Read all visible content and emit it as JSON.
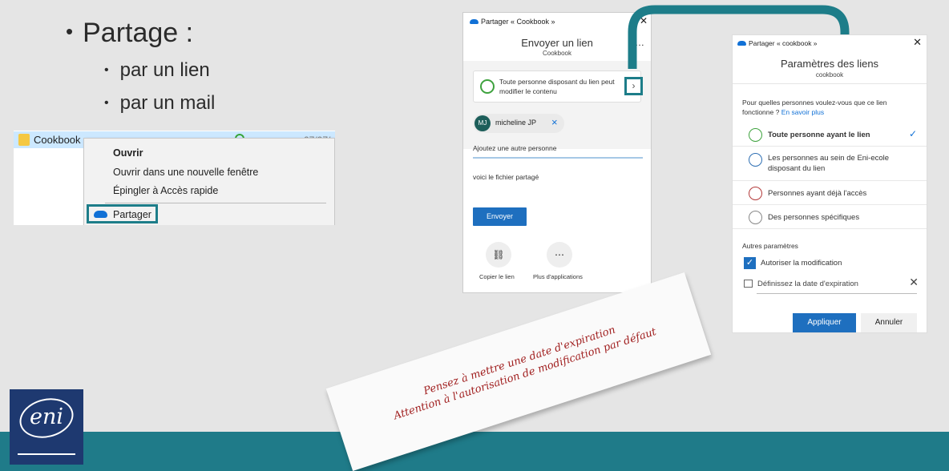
{
  "bullets": {
    "main": "Partage :",
    "sub1": "par un lien",
    "sub2": "par un mail"
  },
  "explorer": {
    "folder_name": "Cookbook",
    "date": "07/07/",
    "menu": [
      "Ouvrir",
      "Ouvrir dans une nouvelle fenêtre",
      "Épingler à Accès rapide",
      "Partager"
    ]
  },
  "send_link": {
    "window_title": "Partager « Cookbook »",
    "heading": "Envoyer un lien",
    "subheading": "Cookbook",
    "link_desc": "Toute personne disposant du lien peut modifier le contenu",
    "chip_initials": "MJ",
    "chip_name": "micheline JP",
    "add_placeholder": "Ajoutez une autre personne",
    "message": "voici le fichier partagé",
    "send_button": "Envoyer",
    "copy_link": "Copier le lien",
    "more_apps": "Plus d'applications"
  },
  "link_settings": {
    "window_title": "Partager « cookbook »",
    "heading": "Paramètres des liens",
    "subheading": "cookbook",
    "question": "Pour quelles personnes voulez-vous que ce lien fonctionne ?",
    "learn_more": "En savoir plus",
    "options": [
      "Toute personne ayant le lien",
      "Les personnes au sein de Eni-ecole disposant du lien",
      "Personnes ayant déjà l'accès",
      "Des personnes spécifiques"
    ],
    "other_params": "Autres paramètres",
    "allow_edit": "Autoriser la modification",
    "expiration": "Définissez la date d'expiration",
    "apply": "Appliquer",
    "cancel": "Annuler"
  },
  "note": {
    "line1": "Pensez à mettre une date d'expiration",
    "line2": "Attention à l'autorisation de modification par défaut"
  },
  "logo_text": "eni"
}
